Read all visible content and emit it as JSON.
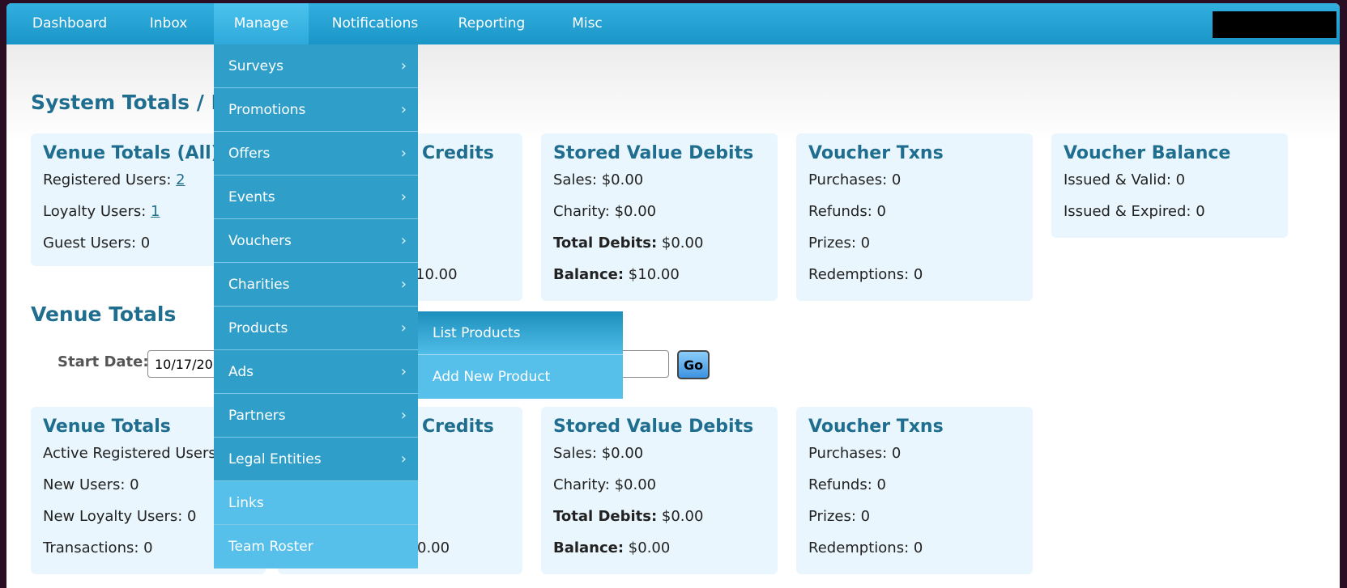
{
  "nav": {
    "items": [
      "Dashboard",
      "Inbox",
      "Manage",
      "Notifications",
      "Reporting",
      "Misc"
    ]
  },
  "section1": {
    "title": "System Totals / Pro",
    "panels": {
      "venue_all": {
        "title": "Venue Totals (All)",
        "registered_label": "Registered Users: ",
        "registered_value": "2",
        "loyalty_label": "Loyalty Users: ",
        "loyalty_value": "1",
        "guest": "Guest Users: 0"
      },
      "credits": {
        "title": "Credits",
        "balance": "10.00"
      },
      "debits": {
        "title": "Stored Value Debits",
        "sales": "Sales: $0.00",
        "charity": "Charity: $0.00",
        "total_label": "Total Debits:",
        "total_value": " $0.00",
        "balance_label": "Balance:",
        "balance_value": " $10.00"
      },
      "voucher_txns": {
        "title": "Voucher Txns",
        "purchases": "Purchases: 0",
        "refunds": "Refunds: 0",
        "prizes": "Prizes: 0",
        "redemptions": "Redemptions: 0"
      },
      "voucher_balance": {
        "title": "Voucher Balance",
        "issued_valid": "Issued & Valid: 0",
        "issued_expired": "Issued & Expired: 0"
      }
    }
  },
  "section2": {
    "title": "Venue Totals",
    "start_label": "Start Date:",
    "start_value": "10/17/202",
    "go": "Go",
    "panels": {
      "venue": {
        "title": "Venue Totals",
        "active": "Active Registered Users",
        "new_users": "New Users: 0",
        "new_loyalty": "New Loyalty Users: 0",
        "transactions": "Transactions: 0"
      },
      "credits": {
        "title": "Credits",
        "balance": "0.00"
      },
      "debits": {
        "title": "Stored Value Debits",
        "sales": "Sales: $0.00",
        "charity": "Charity: $0.00",
        "total_label": "Total Debits:",
        "total_value": " $0.00",
        "balance_label": "Balance:",
        "balance_value": " $0.00"
      },
      "voucher_txns": {
        "title": "Voucher Txns",
        "purchases": "Purchases: 0",
        "refunds": "Refunds: 0",
        "prizes": "Prizes: 0",
        "redemptions": "Redemptions: 0"
      }
    }
  },
  "manage_menu": {
    "items": [
      "Surveys",
      "Promotions",
      "Offers",
      "Events",
      "Vouchers",
      "Charities",
      "Products",
      "Ads",
      "Partners",
      "Legal Entities",
      "Links",
      "Team Roster"
    ],
    "chevron": "›"
  },
  "products_submenu": {
    "items": [
      "List Products",
      "Add New Product"
    ]
  }
}
